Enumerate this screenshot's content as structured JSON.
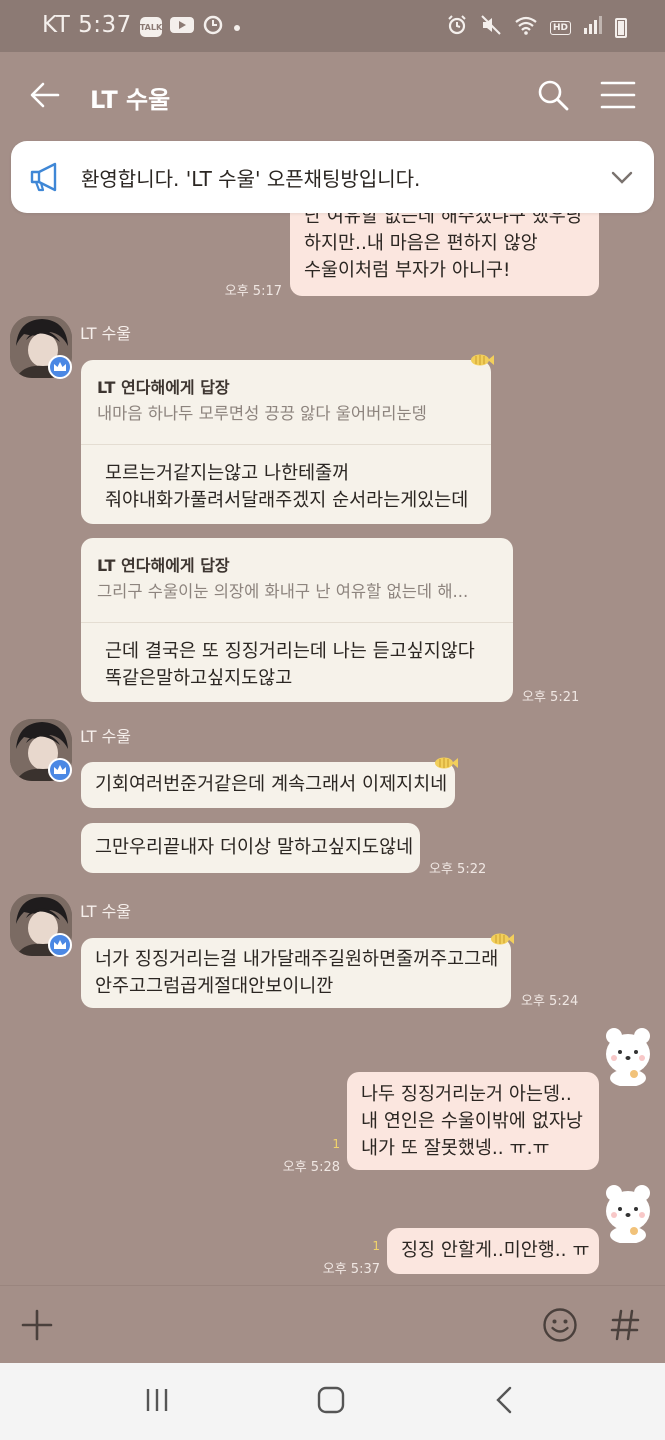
{
  "status_bar": {
    "carrier_time": "KT 5:37",
    "icons": [
      "talk-icon",
      "youtube-icon",
      "timer-icon",
      "dot-icon"
    ],
    "talk_badge": "TALK",
    "right_icons": [
      "alarm-icon",
      "mute-icon",
      "wifi-icon",
      "hd-icon",
      "signal-icon",
      "battery-icon"
    ],
    "hd_label": "HD"
  },
  "header": {
    "title": "LT 수울",
    "back_icon": "arrow-left-icon",
    "search_icon": "search-icon",
    "menu_icon": "hamburger-menu-icon"
  },
  "notice": {
    "icon": "megaphone-icon",
    "text": "환영합니다. 'LT 수울' 오픈채팅방입니다.",
    "chevron_icon": "chevron-down-icon"
  },
  "messages": [
    {
      "id": "m1",
      "side": "mine",
      "lines": [
        "난 여유할 없는데 해주겠냐구 했우낭",
        "하지만..내 마음은 편하지 않앙",
        "수울이처럼 부자가 아니구!"
      ],
      "time": "오후 5:17"
    },
    {
      "id": "m2",
      "side": "theirs",
      "sender": "LT 수울",
      "reply_to": "LT 연다해에게 답장",
      "quote": "내마음 하나두 모루면성 끙끙 앓다 울어버리눈뎅",
      "lines": [
        "모르는거같지는않고 나한테줄꺼",
        "줘야내화가풀려서달래주겠지 순서라는게있는데"
      ]
    },
    {
      "id": "m3",
      "side": "theirs",
      "reply_to": "LT 연다해에게 답장",
      "quote": "그리구 수울이눈 의장에 화내구 난 여유할 없는데 해...",
      "lines": [
        "근데 결국은 또 징징거리는데 나는 듣고싶지않다",
        "똑같은말하고싶지도않고"
      ],
      "time": "오후 5:21"
    },
    {
      "id": "m4",
      "side": "theirs",
      "sender": "LT 수울",
      "lines": [
        "기회여러번준거같은데 계속그래서 이제지치네"
      ]
    },
    {
      "id": "m5",
      "side": "theirs",
      "lines": [
        "그만우리끝내자 더이상 말하고싶지도않네"
      ],
      "time": "오후 5:22"
    },
    {
      "id": "m6",
      "side": "theirs",
      "sender": "LT 수울",
      "lines": [
        "너가 징징거리는걸 내가달래주길원하면줄꺼주고그래",
        "안주고그럼곱게절대안보이니깐"
      ],
      "time": "오후 5:24"
    },
    {
      "id": "m7",
      "side": "mine",
      "lines": [
        "나두 징징거리눈거 아는뎅..",
        "내 연인은 수울이밖에 없자낭",
        "내가 또 잘못했넹.. ㅠ.ㅠ"
      ],
      "time": "오후 5:28",
      "unread": "1"
    },
    {
      "id": "m8",
      "side": "mine",
      "lines": [
        "징징 안할게..미안행.. ㅠ"
      ],
      "time": "오후 5:37",
      "unread": "1"
    }
  ],
  "input_bar": {
    "plus_icon": "plus-icon",
    "emoji_icon": "emoji-icon",
    "hash_icon": "hash-icon"
  },
  "nav_bar": {
    "icons": [
      "recents-icon",
      "home-icon",
      "back-icon"
    ]
  },
  "colors": {
    "chat_background": "#a48f88",
    "my_bubble": "#fbe6df",
    "their_bubble": "#f6f2ea",
    "crown_badge": "#4b88e4",
    "unread_count": "#f1d36b"
  }
}
